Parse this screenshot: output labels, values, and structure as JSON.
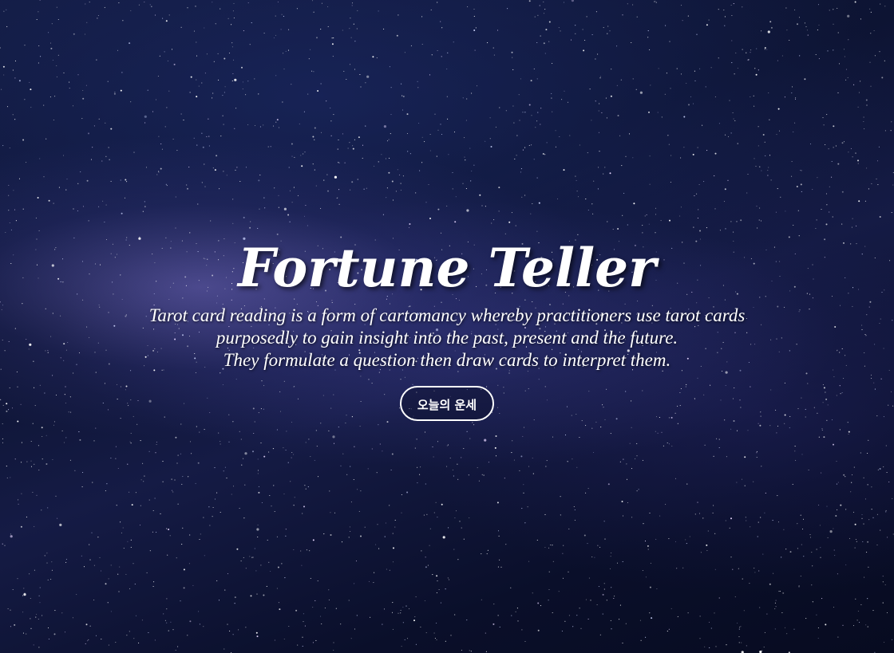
{
  "hero": {
    "title": "Fortune Teller",
    "description_lines": [
      "Tarot card reading is a form of cartomancy whereby practitioners use tarot cards",
      "purposedly to gain insight into the past, present and the future.",
      "They formulate a question then draw cards to interpret them."
    ],
    "cta_label": "오늘의 운세"
  },
  "colors": {
    "text": "#ffffff",
    "background": "#0d1433",
    "nebula": "#7a6ec8"
  },
  "background": {
    "icon": "starry-night-sky"
  }
}
